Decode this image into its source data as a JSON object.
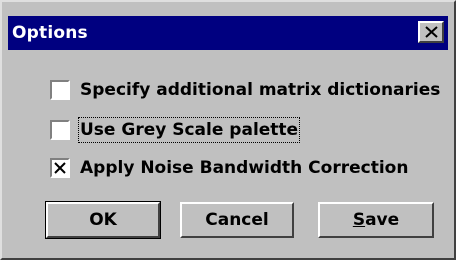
{
  "window": {
    "title": "Options"
  },
  "options": [
    {
      "label": "Specify additional matrix dictionaries",
      "checked": false
    },
    {
      "label": "Use Grey Scale palette",
      "checked": false
    },
    {
      "label": "Apply Noise Bandwidth Correction",
      "checked": true
    }
  ],
  "buttons": {
    "ok": "OK",
    "cancel": "Cancel",
    "save_mnemonic": "S",
    "save_rest": "ave"
  },
  "icons": {
    "close": "close-icon",
    "check": "check-mark-icon"
  }
}
